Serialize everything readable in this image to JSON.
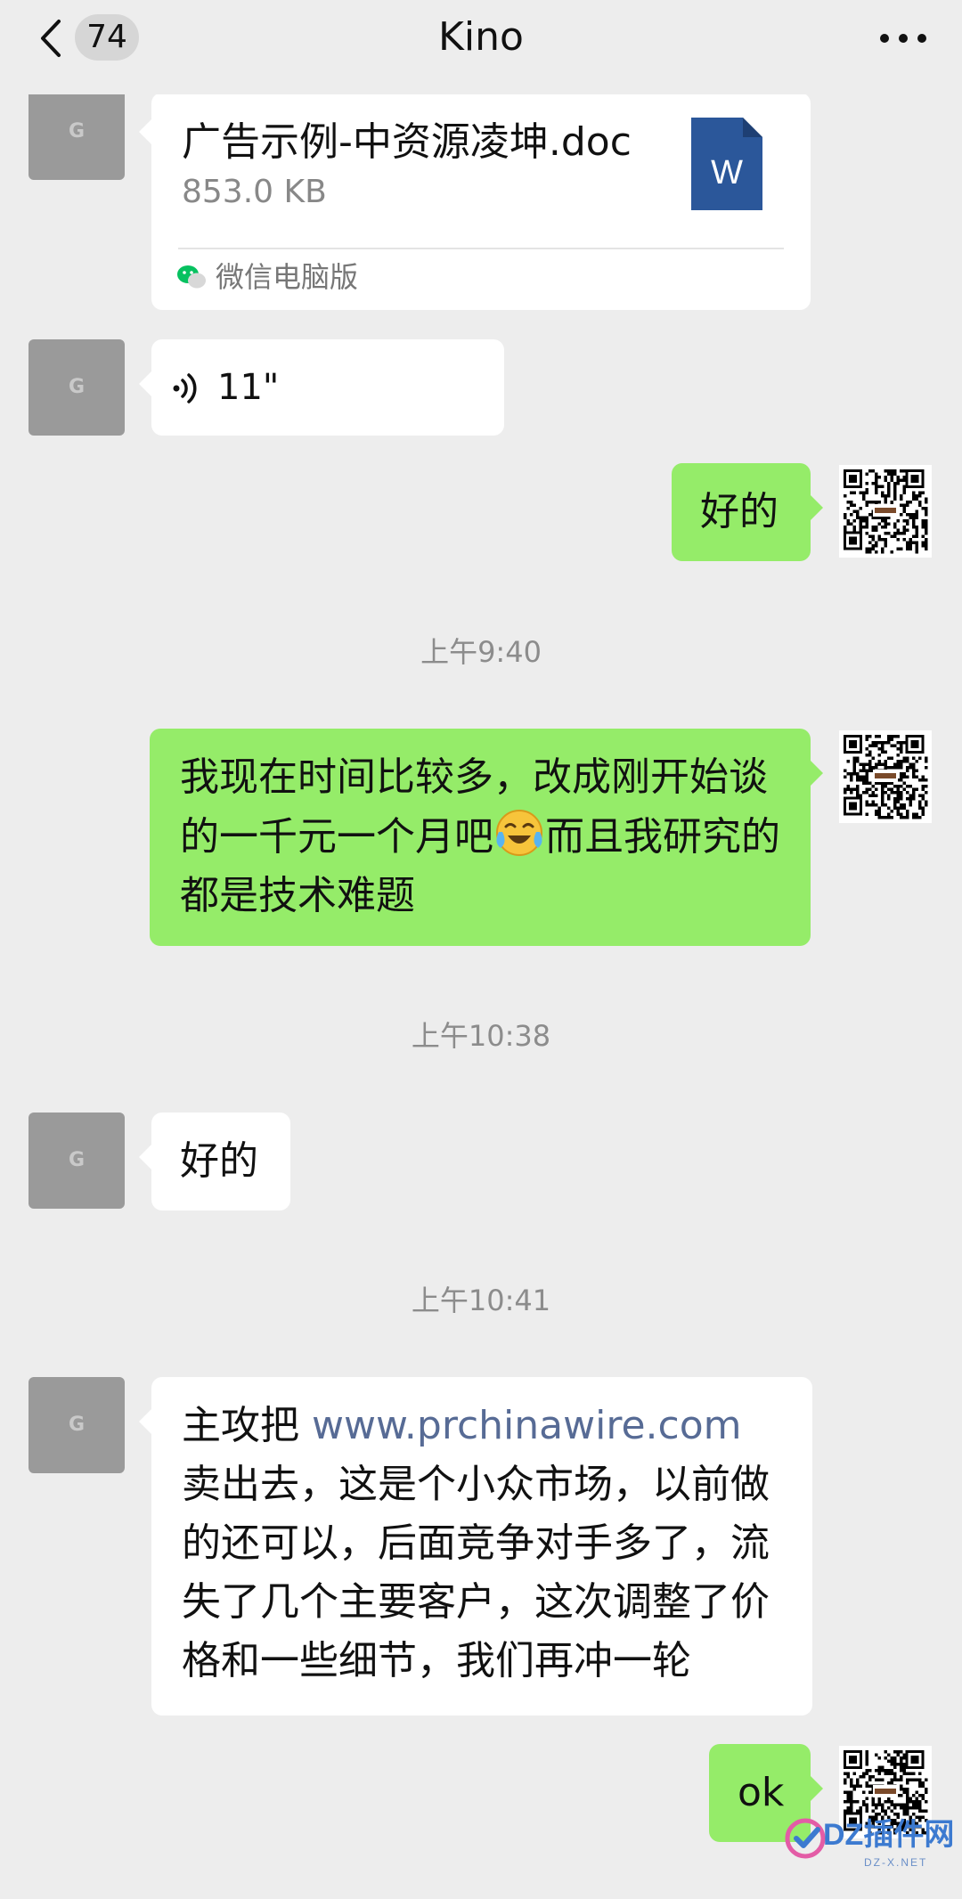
{
  "header": {
    "title": "Kino",
    "unread_count": "74"
  },
  "messages": {
    "file": {
      "name": "广告示例-中资源凌坤.doc",
      "size": "853.0 KB",
      "source": "微信电脑版",
      "icon_letter": "W"
    },
    "voice": {
      "duration": "11\""
    },
    "reply1": "好的",
    "time1": "上午9:40",
    "msg_out_long": {
      "part1": "我现在时间比较多，改成刚开始谈的一千元一个月吧",
      "part2": "而且我研究的都是技术难题"
    },
    "time2": "上午10:38",
    "reply2": "好的",
    "time3": "上午10:41",
    "msg_in_long": {
      "prefix": "主攻把 ",
      "link": "www.prchinawire.com",
      "suffix": " 卖出去，这是个小众市场，以前做的还可以，后面竞争对手多了，流失了几个主要客户，这次调整了价格和一些细节，我们再冲一轮"
    },
    "reply3": "ok"
  },
  "avatar_letter": "G",
  "watermark": {
    "text": "DZ插件网",
    "sub": "DZ-X.NET"
  },
  "colors": {
    "background": "#ededed",
    "bubble_in": "#ffffff",
    "bubble_out": "#95ec69",
    "link": "#576b95",
    "word_blue": "#2b579a",
    "wechat_green": "#07c160"
  }
}
